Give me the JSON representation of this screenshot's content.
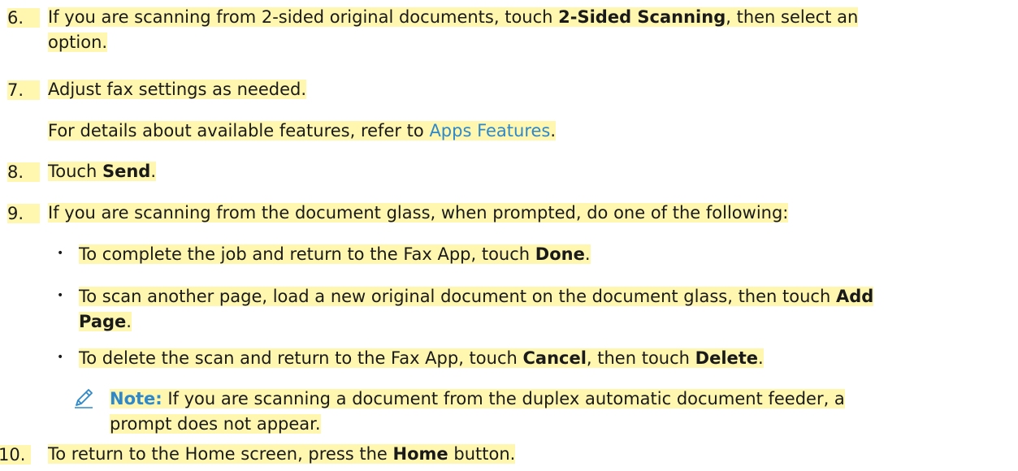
{
  "steps": [
    {
      "num": "6.",
      "pre": "If you are scanning from 2-sided original documents, touch ",
      "bold": "2-Sided Scanning",
      "post_line1": ", then select an",
      "line2": "option."
    },
    {
      "num": "7.",
      "text": "Adjust fax settings as needed.",
      "sub_pre": "For details about available features, refer to ",
      "sub_link": "Apps Features",
      "sub_post": "."
    },
    {
      "num": "8.",
      "pre": "Touch ",
      "bold": "Send",
      "post": "."
    },
    {
      "num": "9.",
      "text": "If you are scanning from the document glass, when prompted, do one of the following:"
    },
    {
      "num": "10.",
      "pre": "To return to the Home screen, press the ",
      "bold": "Home",
      "post": " button."
    }
  ],
  "bullets": [
    {
      "pre": "To complete the job and return to the Fax App, touch ",
      "bold": "Done",
      "post": "."
    },
    {
      "pre": "To scan another page, load a new original document on the document glass, then touch ",
      "bold1": "Add",
      "bold2": "Page",
      "post": "."
    },
    {
      "pre": "To delete the scan and return to the Fax App, touch ",
      "bold1": "Cancel",
      "mid": ", then touch ",
      "bold2": "Delete",
      "post": "."
    }
  ],
  "bullet_char": "•",
  "note": {
    "icon": "pencil-icon",
    "label": "Note:",
    "line1": " If you are scanning a document from the duplex automatic document feeder, a",
    "line2": "prompt does not appear."
  },
  "colors": {
    "highlight": "#fff6b0",
    "link": "#2e88c9"
  }
}
